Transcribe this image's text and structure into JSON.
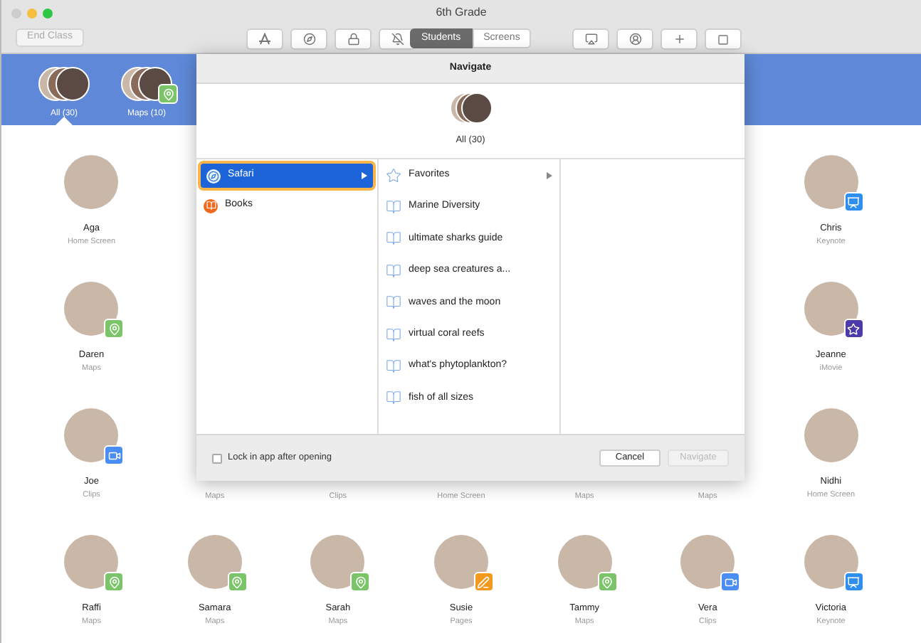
{
  "window": {
    "title": "6th Grade"
  },
  "toolbar": {
    "end_button": "End Class",
    "segments": [
      {
        "label": "Students",
        "selected": true
      },
      {
        "label": "Screens",
        "selected": false
      }
    ]
  },
  "groups": [
    {
      "label": "All (30)",
      "selected": true,
      "kind": "plain"
    },
    {
      "label": "Maps (10)",
      "selected": false,
      "kind": "maps"
    }
  ],
  "students": [
    [
      {
        "name": "Aga",
        "app": "Home Screen",
        "kind": "plain"
      },
      {
        "name": "Chris",
        "app": "Keynote",
        "kind": "keynote"
      }
    ],
    [
      {
        "name": "Daren",
        "app": "Maps",
        "kind": "maps"
      },
      {
        "name": "Jeanne",
        "app": "iMovie",
        "kind": "imovie"
      }
    ],
    [
      {
        "name": "Joe",
        "app": "Clips",
        "kind": "clips"
      },
      {
        "app": "Maps",
        "kind": "covered"
      },
      {
        "app": "Clips",
        "kind": "covered"
      },
      {
        "app": "Home Screen",
        "kind": "covered"
      },
      {
        "app": "Maps",
        "kind": "covered"
      },
      {
        "app": "Maps",
        "kind": "covered"
      },
      {
        "name": "Nidhi",
        "app": "Home Screen",
        "kind": "plain"
      }
    ],
    [
      {
        "name": "Raffi",
        "app": "Maps",
        "kind": "maps"
      },
      {
        "name": "Samara",
        "app": "Maps",
        "kind": "maps"
      },
      {
        "name": "Sarah",
        "app": "Maps",
        "kind": "maps"
      },
      {
        "name": "Susie",
        "app": "Pages",
        "kind": "pages"
      },
      {
        "name": "Tammy",
        "app": "Maps",
        "kind": "maps"
      },
      {
        "name": "Vera",
        "app": "Clips",
        "kind": "clips"
      },
      {
        "name": "Victoria",
        "app": "Keynote",
        "kind": "keynote"
      }
    ]
  ],
  "dialog": {
    "title": "Navigate",
    "group": "All (30)",
    "apps": [
      {
        "label": "Safari",
        "kind": "safari",
        "selected": true,
        "submenu": true
      },
      {
        "label": "Books",
        "kind": "books",
        "selected": false,
        "submenu": false
      }
    ],
    "items": [
      {
        "label": "Favorites",
        "kind": "folder"
      },
      {
        "label": "Marine Diversity",
        "kind": "bookmark"
      },
      {
        "label": "ultimate sharks guide",
        "kind": "bookmark"
      },
      {
        "label": "deep sea creatures a...",
        "kind": "bookmark"
      },
      {
        "label": "waves and the moon",
        "kind": "bookmark"
      },
      {
        "label": "virtual coral reefs",
        "kind": "bookmark"
      },
      {
        "label": "what's phytoplankton?",
        "kind": "bookmark"
      },
      {
        "label": "fish of all sizes",
        "kind": "bookmark"
      }
    ],
    "lock": {
      "label": "Lock in app after opening",
      "checked": false
    },
    "buttons": [
      {
        "label": "Cancel",
        "disabled": false
      },
      {
        "label": "Navigate",
        "disabled": true
      }
    ]
  }
}
